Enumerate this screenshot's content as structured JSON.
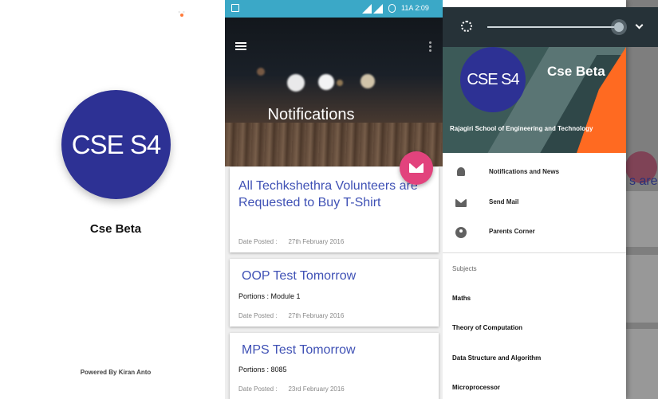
{
  "splash": {
    "logo_text": "CSE S4",
    "app_name": "Cse Beta",
    "powered_by": "Powered By Kiran Anto"
  },
  "notifications": {
    "status_time": "11A 2:09",
    "title": "Notifications",
    "date_label": "Date Posted :",
    "cards": [
      {
        "title": "All Techkshethra Volunteers are Requested to  Buy T-Shirt",
        "portions": "",
        "date": "27th February 2016"
      },
      {
        "title": "OOP Test Tomorrow",
        "portions": "Portions : Module 1",
        "date": "27th February 2016"
      },
      {
        "title": "MPS Test Tomorrow",
        "portions": "Portions : 8085",
        "date": "23rd February 2016"
      }
    ],
    "fab_icon": "mail-icon",
    "accent_color": "#3f51b5",
    "fab_color": "#e2437d"
  },
  "drawer": {
    "brightness_level": 0.97,
    "logo_text": "CSE S4",
    "app_name": "Cse Beta",
    "college": "Rajagiri School of Engineering and Technology",
    "menu": [
      {
        "label": "Notifications and News",
        "icon": "bell-icon"
      },
      {
        "label": "Send Mail",
        "icon": "mail-icon"
      },
      {
        "label": "Parents Corner",
        "icon": "account-icon"
      }
    ],
    "subjects_header": "Subjects",
    "subjects": [
      "Maths",
      "Theory of Computation",
      "Data Structure and Algorithm",
      "Microprocessor"
    ],
    "behind_text": "s are",
    "header_accent": "#ff6a21"
  }
}
